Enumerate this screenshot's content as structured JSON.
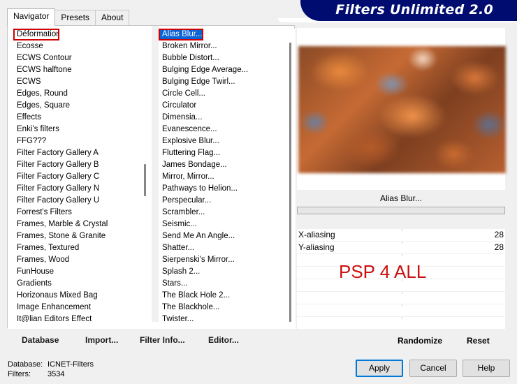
{
  "tabs": [
    "Navigator",
    "Presets",
    "About"
  ],
  "app_title": "Filters Unlimited 2.0",
  "categories": [
    "Déformation",
    "Ecosse",
    "ECWS Contour",
    "ECWS halftone",
    "ECWS",
    "Edges, Round",
    "Edges, Square",
    "Effects",
    "Enki's filters",
    "FFG???",
    "Filter Factory Gallery A",
    "Filter Factory Gallery B",
    "Filter Factory Gallery C",
    "Filter Factory Gallery N",
    "Filter Factory Gallery U",
    "Forrest's Filters",
    "Frames, Marble & Crystal",
    "Frames, Stone & Granite",
    "Frames, Textured",
    "Frames, Wood",
    "FunHouse",
    "Gradients",
    "Horizonaus Mixed Bag",
    "Image Enhancement",
    "It@lian Editors Effect"
  ],
  "filters": [
    "Alias Blur...",
    "Broken Mirror...",
    "Bubble Distort...",
    "Bulging Edge Average...",
    "Bulging Edge Twirl...",
    "Circle Cell...",
    "Circulator",
    "Dimensia...",
    "Evanescence...",
    "Explosive Blur...",
    "Fluttering Flag...",
    "James Bondage...",
    "Mirror, Mirror...",
    "Pathways to Helion...",
    "Perspecular...",
    "Scrambler...",
    "Seismic...",
    "Send Me An Angle...",
    "Shatter...",
    "Sierpenski's Mirror...",
    "Splash 2...",
    "Stars...",
    "The Black Hole 2...",
    "The Blackhole...",
    "Twister..."
  ],
  "selected_category": "Déformation",
  "selected_filter": "Alias Blur...",
  "toolbar": {
    "database": "Database",
    "import": "Import...",
    "filter_info": "Filter Info...",
    "editor": "Editor..."
  },
  "preview": {
    "filter_name": "Alias Blur...",
    "watermark": "PSP 4 ALL"
  },
  "params": [
    {
      "label": "X-aliasing",
      "value": "28"
    },
    {
      "label": "Y-aliasing",
      "value": "28"
    },
    {
      "label": "",
      "value": ""
    },
    {
      "label": "",
      "value": ""
    },
    {
      "label": "",
      "value": ""
    },
    {
      "label": "",
      "value": ""
    },
    {
      "label": "",
      "value": ""
    },
    {
      "label": "",
      "value": ""
    }
  ],
  "right_buttons": {
    "randomize": "Randomize",
    "reset": "Reset"
  },
  "footer": {
    "database_label": "Database:",
    "database_value": "ICNET-Filters",
    "filters_label": "Filters:",
    "filters_value": "3534"
  },
  "dialog_buttons": {
    "apply": "Apply",
    "cancel": "Cancel",
    "help": "Help"
  },
  "colors": {
    "banner": "#000c70",
    "selection": "#0a64d6",
    "highlight_border": "#d00000",
    "watermark": "#cc1010"
  }
}
